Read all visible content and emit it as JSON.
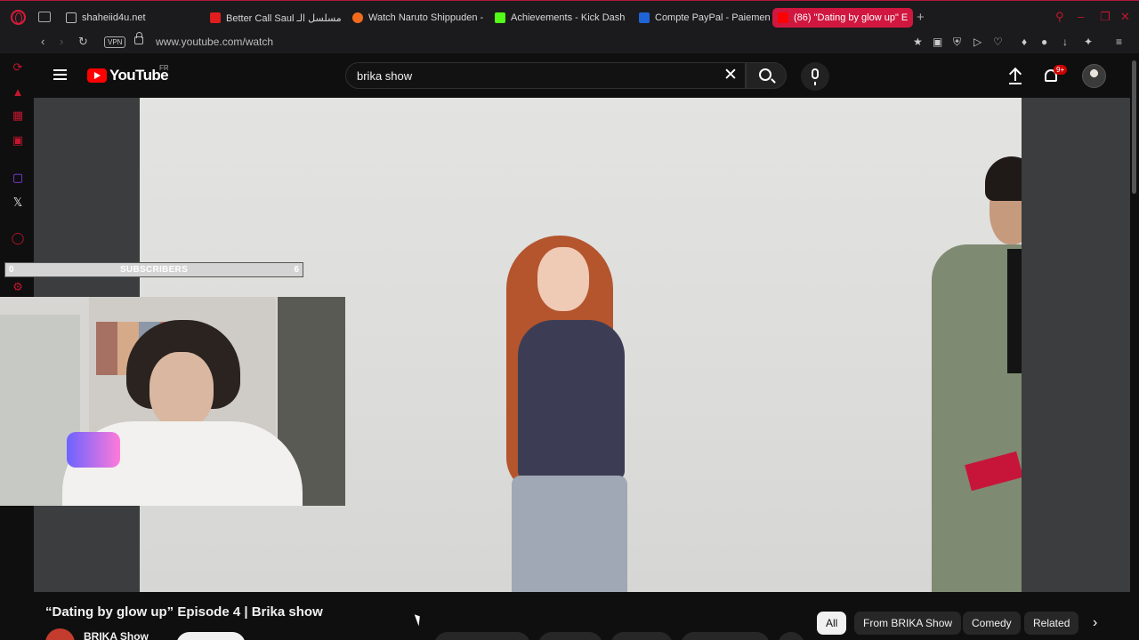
{
  "browser": {
    "tabs": [
      {
        "title": "shaheiid4u.net",
        "favicon_color": "#bbbbbb"
      },
      {
        "title": "Better Call Saul مسلسل الـ",
        "favicon_color": "#e11d1d"
      },
      {
        "title": "Watch Naruto Shippuden -",
        "favicon_color": "#f26b1d"
      },
      {
        "title": "Achievements - Kick Dash",
        "favicon_color": "#53fc18"
      },
      {
        "title": "Compte PayPal - Paiemen",
        "favicon_color": "#1f64d6"
      },
      {
        "title": "(86) \"Dating by glow up\" E",
        "favicon_color": "#ff0000"
      }
    ],
    "address": {
      "vpn_label": "VPN",
      "url": "www.youtube.com/watch"
    }
  },
  "youtube": {
    "logo_text": "YouTube",
    "country": "FR",
    "search": {
      "value": "brika show"
    },
    "notifications_badge": "9+"
  },
  "overlay": {
    "subscribers_label": "SUBSCRIBERS",
    "goal_current": "0",
    "goal_target": "6",
    "progress_fraction": 0.0
  },
  "video": {
    "title": "“Dating by glow up” Episode 4 | Brika show",
    "channel": "BRIKA Show"
  },
  "chips": [
    {
      "label": "All",
      "active": true
    },
    {
      "label": "From BRIKA Show",
      "active": false
    },
    {
      "label": "Comedy",
      "active": false
    },
    {
      "label": "Related",
      "active": false
    }
  ],
  "colors": {
    "opera_red": "#d0173f",
    "youtube_red": "#ff0000",
    "background": "#0f0f0f"
  }
}
